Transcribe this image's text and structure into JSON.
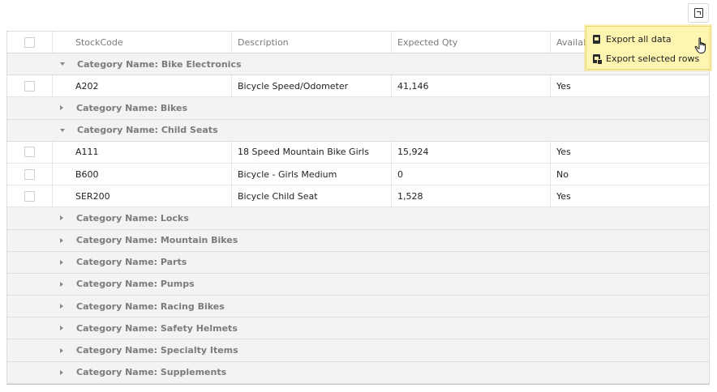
{
  "toolbar": {
    "export_icon": "export-icon"
  },
  "grid": {
    "columns": [
      "StockCode",
      "Description",
      "Expected Qty",
      "Available"
    ],
    "rows": [
      {
        "type": "group",
        "label": "Category Name: Bike Electronics",
        "expanded": true
      },
      {
        "type": "data",
        "stock_code": "A202",
        "description": "Bicycle Speed/Odometer",
        "expected_qty": "41,146",
        "available": "Yes"
      },
      {
        "type": "group",
        "label": "Category Name: Bikes",
        "expanded": false
      },
      {
        "type": "group",
        "label": "Category Name: Child Seats",
        "expanded": true
      },
      {
        "type": "data",
        "stock_code": "A111",
        "description": "18 Speed Mountain Bike Girls",
        "expected_qty": "15,924",
        "available": "Yes"
      },
      {
        "type": "data",
        "stock_code": "B600",
        "description": "Bicycle - Girls Medium",
        "expected_qty": "0",
        "available": "No"
      },
      {
        "type": "data",
        "stock_code": "SER200",
        "description": "Bicycle Child Seat",
        "expected_qty": "1,528",
        "available": "Yes"
      },
      {
        "type": "group",
        "label": "Category Name: Locks",
        "expanded": false
      },
      {
        "type": "group",
        "label": "Category Name: Mountain Bikes",
        "expanded": false
      },
      {
        "type": "group",
        "label": "Category Name: Parts",
        "expanded": false
      },
      {
        "type": "group",
        "label": "Category Name: Pumps",
        "expanded": false
      },
      {
        "type": "group",
        "label": "Category Name: Racing Bikes",
        "expanded": false
      },
      {
        "type": "group",
        "label": "Category Name: Safety Helmets",
        "expanded": false
      },
      {
        "type": "group",
        "label": "Category Name: Specialty Items",
        "expanded": false
      },
      {
        "type": "group",
        "label": "Category Name: Supplements",
        "expanded": false
      }
    ]
  },
  "export_menu": {
    "items": [
      {
        "label": "Export all data",
        "icon": "excel-file-icon"
      },
      {
        "label": "Export selected rows",
        "icon": "excel-file-selection-icon"
      }
    ],
    "highlight_color": "#fdf5b0"
  }
}
